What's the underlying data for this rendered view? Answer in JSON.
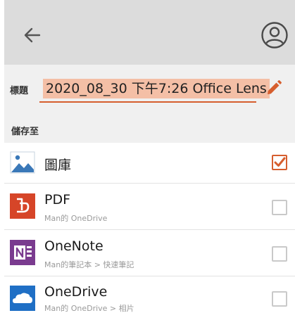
{
  "header": {
    "back_icon": "arrow-left-icon",
    "account_icon": "account-circle-icon"
  },
  "title_field": {
    "label": "標題",
    "value": "2020_08_30 下午7:26 Office Lens",
    "edit_icon": "pencil-icon"
  },
  "save_to": {
    "label": "儲存至",
    "destinations": [
      {
        "icon": "gallery-icon",
        "title": "圖庫",
        "subtitle": "",
        "checked": true
      },
      {
        "icon": "pdf-icon",
        "title": "PDF",
        "subtitle": "Man的 OneDrive",
        "checked": false
      },
      {
        "icon": "onenote-icon",
        "title": "OneNote",
        "subtitle": "Man的筆記本 > 快速筆記",
        "checked": false
      },
      {
        "icon": "onedrive-icon",
        "title": "OneDrive",
        "subtitle": "Man的 OneDrive > 相片",
        "checked": false
      }
    ]
  },
  "colors": {
    "accent": "#d65e2e",
    "title_highlight": "#f4bfa6",
    "app_bar": "#dcdcdc",
    "gallery_blue": "#3a78b8",
    "pdf_red": "#d64528",
    "onenote_purple": "#7a3b8f",
    "onedrive_blue": "#1f6fc5"
  }
}
